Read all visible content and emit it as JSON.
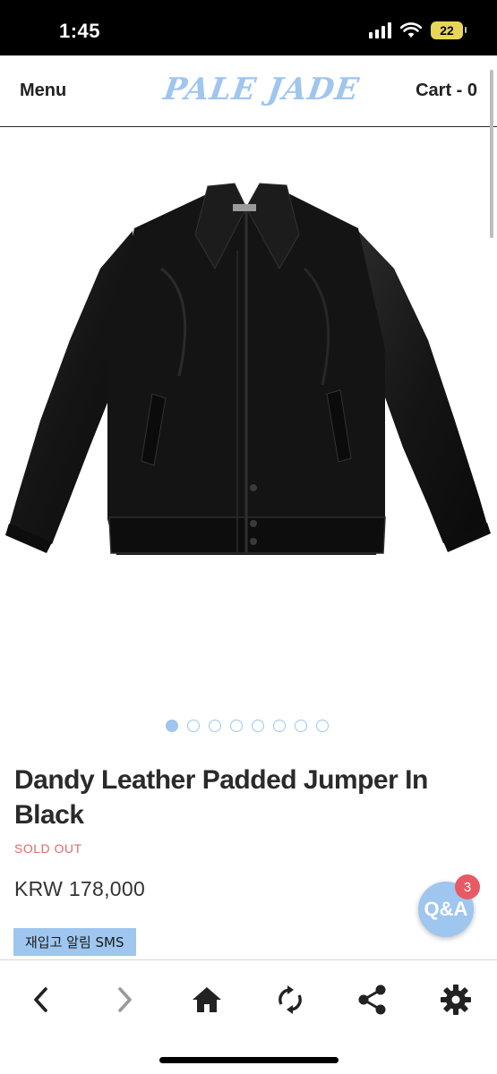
{
  "status_bar": {
    "time": "1:45",
    "battery": "22",
    "icons": [
      "signal-icon",
      "wifi-icon",
      "battery-icon"
    ]
  },
  "header": {
    "menu_label": "Menu",
    "logo_text": "PALE JADE",
    "cart_label": "Cart - 0"
  },
  "product": {
    "title": "Dandy Leather Padded Jumper In Black",
    "status": "SOLD OUT",
    "price": "KRW 178,000",
    "restock_button": "재입고 알림 SMS",
    "carousel_count": 8,
    "carousel_active": 0
  },
  "qa": {
    "label": "Q&A",
    "badge": "3"
  },
  "toolbar": {
    "items": [
      "back-icon",
      "forward-icon",
      "home-icon",
      "reload-icon",
      "share-icon",
      "settings-icon"
    ]
  },
  "colors": {
    "accent": "#9ec6ee",
    "sold_out": "#e06a6a",
    "badge": "#e85a63",
    "battery": "#e8d65a"
  }
}
